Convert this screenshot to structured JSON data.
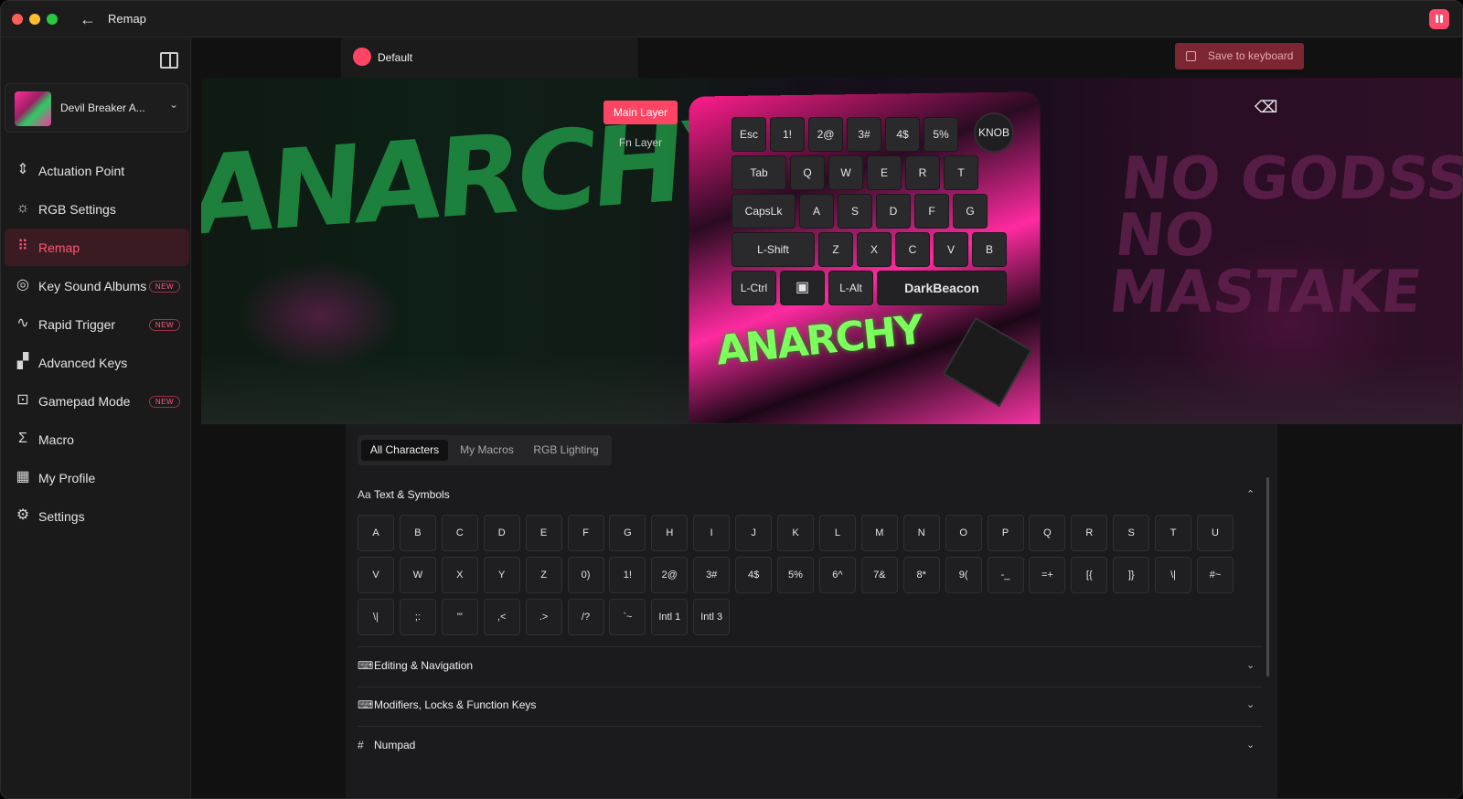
{
  "window": {
    "title": "Remap"
  },
  "sidebar": {
    "device_name": "Devil Breaker A...",
    "items": [
      {
        "label": "Actuation Point",
        "icon": "actuation-icon",
        "badge": ""
      },
      {
        "label": "RGB Settings",
        "icon": "sun-icon",
        "badge": ""
      },
      {
        "label": "Remap",
        "icon": "keyboard-grid-icon",
        "badge": "",
        "active": true
      },
      {
        "label": "Key Sound Albums",
        "icon": "disc-icon",
        "badge": "NEW"
      },
      {
        "label": "Rapid Trigger",
        "icon": "pulse-icon",
        "badge": "NEW"
      },
      {
        "label": "Advanced Keys",
        "icon": "keys-icon",
        "badge": ""
      },
      {
        "label": "Gamepad Mode",
        "icon": "gamepad-icon",
        "badge": "NEW"
      },
      {
        "label": "Macro",
        "icon": "sigma-icon",
        "badge": ""
      },
      {
        "label": "My Profile",
        "icon": "grid-icon",
        "badge": ""
      },
      {
        "label": "Settings",
        "icon": "gear-icon",
        "badge": ""
      }
    ]
  },
  "header": {
    "profile_name": "Default",
    "save_label": "Save to keyboard"
  },
  "hero": {
    "layer_main": "Main Layer",
    "layer_fn": "Fn Layer",
    "graffiti_left": "ANARCHY",
    "graffiti_right_1": "NO GODSS",
    "graffiti_right_2": "NO MASTAKE",
    "device_print": "ANARCHY"
  },
  "keyboard": {
    "knob": "KNOB",
    "rows": [
      [
        "Esc",
        "1!",
        "2@",
        "3#",
        "4$",
        "5%"
      ],
      [
        "Tab",
        "Q",
        "W",
        "E",
        "R",
        "T"
      ],
      [
        "CapsLk",
        "A",
        "S",
        "D",
        "F",
        "G"
      ],
      [
        "L-Shift",
        "Z",
        "X",
        "C",
        "V",
        "B"
      ],
      [
        "L-Ctrl",
        "",
        "L-Alt",
        "DarkBeacon"
      ]
    ]
  },
  "panel": {
    "tabs": [
      "All Characters",
      "My Macros",
      "RGB Lighting"
    ],
    "sections": {
      "text_symbols": "Text & Symbols",
      "editing": "Editing & Navigation",
      "modifiers": "Modifiers, Locks & Function Keys",
      "numpad": "Numpad"
    },
    "chars_row1": [
      "A",
      "B",
      "C",
      "D",
      "E",
      "F",
      "G",
      "H",
      "I",
      "J",
      "K",
      "L",
      "M",
      "N",
      "O",
      "P",
      "Q",
      "R",
      "S",
      "T",
      "U"
    ],
    "chars_row2": [
      "V",
      "W",
      "X",
      "Y",
      "Z",
      "0)",
      "1!",
      "2@",
      "3#",
      "4$",
      "5%",
      "6^",
      "7&",
      "8*",
      "9(",
      "-_",
      "=+",
      "[{",
      "]}",
      "\\|",
      "#~"
    ],
    "chars_row3": [
      "\\|",
      ";:",
      "'\"",
      ",<",
      ".>",
      "/?",
      "`~",
      "Intl 1",
      "Intl 3"
    ]
  },
  "colors": {
    "accent": "#ff4564",
    "active_nav_bg": "#3b1b22",
    "save_bg": "#7d2633"
  }
}
